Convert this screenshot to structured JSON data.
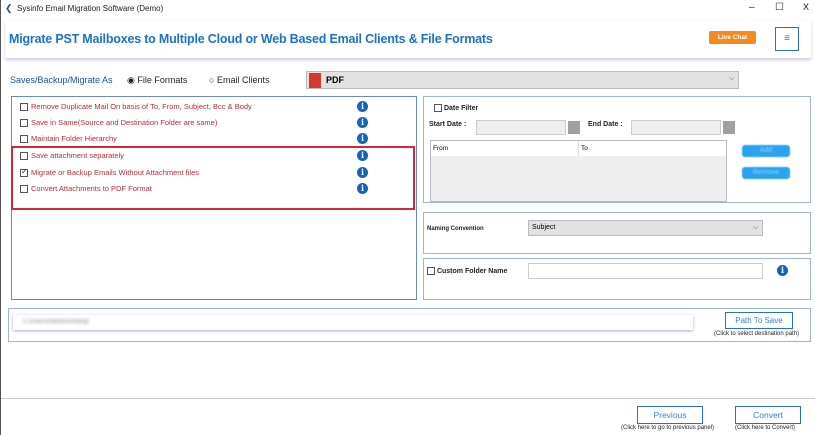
{
  "window": {
    "title": "Sysinfo Email Migration Software (Demo)",
    "minimize": "–",
    "maximize": "☐",
    "close": "X"
  },
  "banner": {
    "heading": "Migrate PST Mailboxes to Multiple Cloud or Web Based Email Clients & File Formats",
    "live_chat": "Live Chat",
    "menu_icon": "≡"
  },
  "save_as": {
    "label": "Saves/Backup/Migrate As",
    "options": [
      {
        "label": "File Formats",
        "selected": true
      },
      {
        "label": "Email Clients",
        "selected": false
      }
    ],
    "format_selected": "PDF"
  },
  "options": [
    {
      "label": "Remove Duplicate Mail On basis of To, From, Subject, Bcc & Body",
      "checked": false
    },
    {
      "label": "Save in Same(Source and Destination Folder are same)",
      "checked": false
    },
    {
      "label": "Maintain Folder Hierarchy",
      "checked": false
    },
    {
      "label": "Save attachment separately",
      "checked": false
    },
    {
      "label": "Migrate or Backup Emails Without Attachment files",
      "checked": true
    },
    {
      "label": "Convert Attachments to PDF Format",
      "checked": false
    }
  ],
  "date_filter": {
    "label": "Date Filter",
    "checked": false,
    "start_label": "Start Date :",
    "end_label": "End Date :",
    "columns": [
      "From",
      "To"
    ],
    "add": "Add",
    "remove": "Remove"
  },
  "naming": {
    "label": "Naming Convention",
    "selected": "Subject"
  },
  "custom_folder": {
    "label": "Custom Folder Name",
    "checked": false,
    "value": ""
  },
  "path": {
    "value": "C:\\Users\\Admin\\Desktop",
    "button": "Path To Save",
    "hint": "(Click to select destination path)"
  },
  "footer": {
    "previous": "Previous",
    "previous_hint": "(Click here to go to previous panel)",
    "convert": "Convert",
    "convert_hint": "(Click here to Convert)"
  },
  "colors": {
    "accent": "#1a73c8",
    "option_text": "#c0283a",
    "live_chat": "#f58a1f",
    "highlight": "#d0283a"
  }
}
